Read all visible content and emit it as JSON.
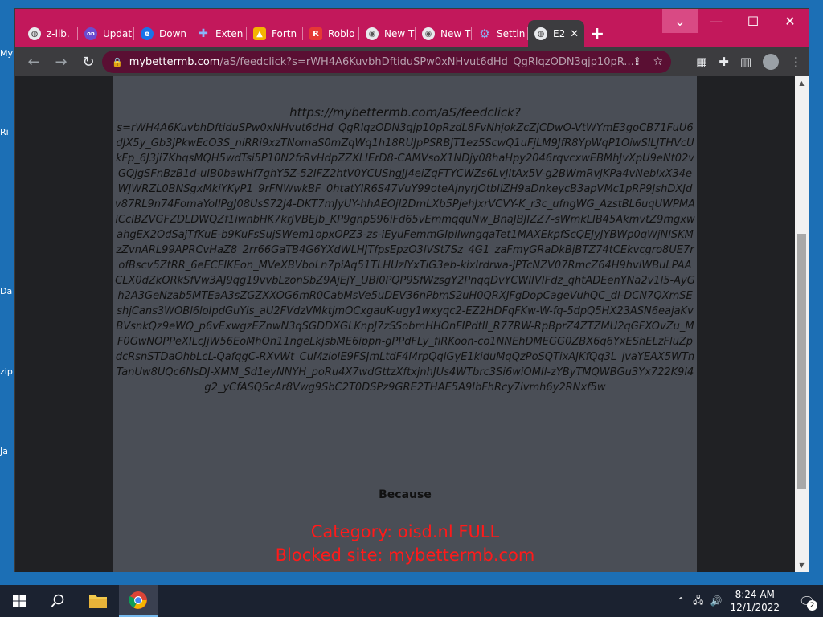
{
  "desktop": {
    "fragments": [
      "My",
      "Ri",
      "Da",
      "zip",
      "Ja"
    ]
  },
  "browser": {
    "tabs": [
      {
        "label": "z-lib.",
        "icon": "globe-icon"
      },
      {
        "label": "Updat",
        "icon": "vpn-icon"
      },
      {
        "label": "Down",
        "icon": "edge-icon"
      },
      {
        "label": "Exten",
        "icon": "puzzle-icon"
      },
      {
        "label": "Fortn",
        "icon": "fortnite-icon"
      },
      {
        "label": "Roblo",
        "icon": "roblox-icon"
      },
      {
        "label": "New T",
        "icon": "chrome-icon"
      },
      {
        "label": "New T",
        "icon": "chrome-icon"
      },
      {
        "label": "Settin",
        "icon": "settings-icon"
      },
      {
        "label": "E2",
        "icon": "globe-icon",
        "active": true
      }
    ],
    "new_tab_symbol": "+",
    "address": {
      "host": "mybettermb.com",
      "path": "/aS/feedclick?s=rWH4A6KuvbhDftiduSPw0xNHvut6dHd_QgRlqzODN3qjp10pR..."
    }
  },
  "page": {
    "url_heading": "https://mybettermb.com/aS/feedclick?",
    "url_body": "s=rWH4A6KuvbhDftiduSPw0xNHvut6dHd_QgRlqzODN3qjp10pRzdL8FvNhjokZcZjCDwO-VtWYmE3goCB71FuU6dJX5y_Gb3jPkwEcO3S_niRRi9xzTNomaS0mZqWq1h18RUJpPSRBjT1ez5ScwQ1uFjLM9JfR8YpWqP1OiwSlLJTHVcUkFp_6J3ji7KhqsMQH5wdTsi5P10N2frRvHdpZZXLIErD8-CAMVsoX1NDjy08haHpy2046rqvcxwEBMhJvXpU9eNt02vGQjgSFnBzB1d-uIB0bawHf7ghY5Z-52IFZ2htV0YCUShgJJ4eiZqFTYCWZs6LvJltAx5V-g2BWmRvJKPa4vNeblxX34eWJWRZL0BNSgxMkiYKyP1_9rFNWwkBF_0htatYIR6S47VuY99oteAjnyrJOtbIlZH9aDnkeycB3apVMc1pRP9JshDXJdv87RL9n74FomaYoIlPgJ08UsS72J4-DKT7mJyUY-hhAEOjl2DmLXb5PjehJxrVCVY-K_r3c_ufngWG_AzstBL6uqUWPMAiCciBZVGFZDLDWQZf1iwnbHK7krJVBEJb_KP9gnpS96iFd65vEmmqquNw_BnaJBJIZZ7-sWmkLIB45AkmvtZ9mgxwahgEX2OdSajTfKuE-b9KuFsSujSWem1opxOPZ3-zs-iEyuFemmGIpiIwngqaTet1MAXEkpfScQEJyJYBWp0qWjNlSKMzZvnARL99APRCvHaZ8_2rr66GaTB4G6YXdWLHJTfpsEpzO3lVSt7Sz_4G1_zaFmyGRaDkBjBTZ74tCEkvcgro8UE7rofBscv5ZtRR_6eECFIKEon_MVeXBVboLn7piAq51TLHUzlYxTiG3eb-kixIrdrwa-jPTcNZV07RmcZ64H9hvlWBuLPAACLX0dZkORkSfVw3AJ9qg19vvbLzonSbZ9AjEjY_UBi0PQP9SfWzsgY2PnqqDvYCWIIVIFdz_qhtADEenYNa2v1l5-AyGh2A3GeNzab5MTEaA3sZGZXXOG6mR0CabMsVe5uDEV36nPbmS2uH0QRXJFgDopCageVuhQC_dl-DCN7QXmSEshjCans3WOBl6loIpdGuYis_aU2FVdzVMktjmOCxgauK-ugy1wxyqc2-EZ2HDFqFKw-W-fq-5dpQ5HX23ASN6eajaKvBVsnkQz9eWQ_p6vExwgzEZnwN3qSGDDXGLKnpJ7zSSobmHHOnFIPdtIl_R77RW-RpBprZ4ZTZMU2qGFXOvZu_MF0GwNOPPeXILcJjW56EoMhOn11ngeLkjsbME6ippn-gPPdFLy_flRKoon-co1NNEhDMEGG0ZBX6q6YxEShELzFluZpdcRsnSTDaOhbLcL-QafqgC-RXvWt_CuMzioIE9FSJmLtdF4MrpQqlGyE1kiduMqQzPoSQTixAJKfQq3L_jvaYEAX5WTnTanUw8UQc6NsDJ-XMM_Sd1eyNNYH_poRu4X7wdGttzXftxjnhJUs4WTbrc3Si6wiOMIl-zYByTMQWBGu3Yx722K9i4g2_yCfASQScAr8Vwg9SbC2T0DSPz9GRE2THAE5A9IbFhRcy7ivmh6y2RNxf5w",
    "because_label": "Because",
    "category_line": "Category: oisd.nl FULL",
    "blocked_line": "Blocked site: mybettermb.com"
  },
  "taskbar": {
    "time": "8:24 AM",
    "date": "12/1/2022",
    "notification_count": "2"
  },
  "colors": {
    "titlebar": "#c2185b",
    "blocked_text": "#ff1a1a",
    "page_bg": "#4a4e56"
  }
}
